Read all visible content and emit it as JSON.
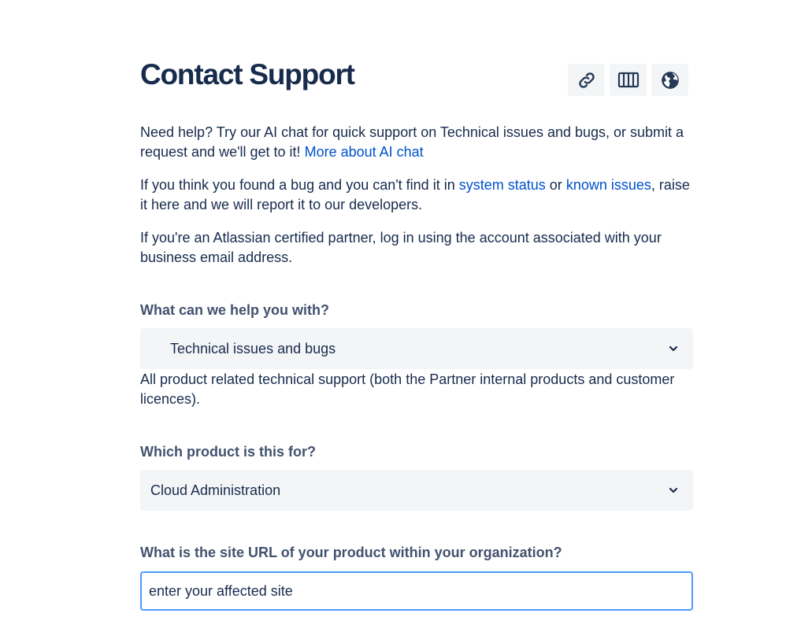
{
  "header": {
    "title": "Contact Support",
    "icons": [
      "link-icon",
      "board-icon",
      "globe-icon"
    ]
  },
  "intro": {
    "p1_text": "Need help? Try our AI chat for quick support on Technical issues and bugs, or submit a request and we'll get to it!",
    "p1_link": "More about AI chat",
    "p2_before": "If you think you found a bug and you can't find it in",
    "p2_link1": "system status",
    "p2_middle": "or",
    "p2_link2": "known issues",
    "p2_after": ", raise it here and we will report it to our developers.",
    "p3_text": "If you're an Atlassian certified partner, log in using the account associated with your business email address."
  },
  "form": {
    "help_label": "What can we help you with?",
    "help_value": "Technical issues and bugs",
    "help_description": "All product related technical support (both the Partner internal products and customer licences).",
    "product_label": "Which product is this for?",
    "product_value": "Cloud Administration",
    "site_label": "What is the site URL of your product within your organization?",
    "site_placeholder": "enter your affected site"
  },
  "colors": {
    "text": "#172b4d",
    "label": "#42526e",
    "link": "#0052cc",
    "field_bg": "#f4f5f7",
    "focus_border": "#4c9aff"
  }
}
